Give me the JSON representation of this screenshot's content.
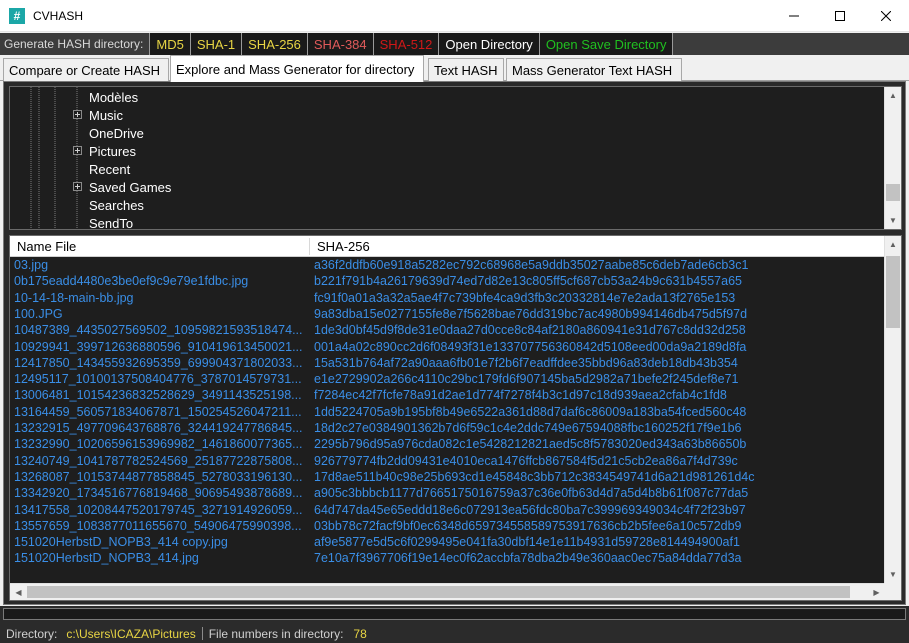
{
  "window": {
    "title": "CVHASH",
    "app_icon_glyph": "#"
  },
  "toolbar": {
    "label": "Generate HASH directory:",
    "buttons": [
      {
        "label": "MD5",
        "color": "#e8d544"
      },
      {
        "label": "SHA-1",
        "color": "#e8d544"
      },
      {
        "label": "SHA-256",
        "color": "#e8d544"
      },
      {
        "label": "SHA-384",
        "color": "#e05a5a"
      },
      {
        "label": "SHA-512",
        "color": "#d01818"
      },
      {
        "label": "Open Directory",
        "color": "#ffffff"
      },
      {
        "label": "Open Save Directory",
        "color": "#20c020"
      }
    ]
  },
  "tabs": [
    {
      "label": "Compare or Create HASH",
      "active": false
    },
    {
      "label": "Explore and Mass Generator for directory",
      "active": true
    },
    {
      "label": "Text HASH",
      "active": false
    },
    {
      "label": "Mass Generator Text HASH",
      "active": false
    }
  ],
  "tree": {
    "items": [
      {
        "label": "Modèles",
        "expandable": false
      },
      {
        "label": "Music",
        "expandable": true
      },
      {
        "label": "OneDrive",
        "expandable": false
      },
      {
        "label": "Pictures",
        "expandable": true
      },
      {
        "label": "Recent",
        "expandable": false
      },
      {
        "label": "Saved Games",
        "expandable": true
      },
      {
        "label": "Searches",
        "expandable": false
      },
      {
        "label": "SendTo",
        "expandable": false
      }
    ]
  },
  "file_list": {
    "columns": [
      "Name File",
      "SHA-256"
    ],
    "rows": [
      [
        "03.jpg",
        "a36f2ddfb60e918a5282ec792c68968e5a9ddb35027aabe85c6deb7ade6cb3c1"
      ],
      [
        "0b175eadd4480e3be0ef9c9e79e1fdbc.jpg",
        "b221f791b4a26179639d74ed7d82e13c805ff5cf687cb53a24b9c631b4557a65"
      ],
      [
        "10-14-18-main-bb.jpg",
        "fc91f0a01a3a32a5ae4f7c739bfe4ca9d3fb3c20332814e7e2ada13f2765e153"
      ],
      [
        "100.JPG",
        "9a83dba15e0277155fe8e7f5628bae76dd319bc7ac4980b994146db475d5f97d"
      ],
      [
        "10487389_4435027569502_10959821593518474...",
        "1de3d0bf45d9f8de31e0daa27d0cce8c84af2180a860941e31d767c8dd32d258"
      ],
      [
        "10929941_399712636880596_910419613450021...",
        "001a4a02c890cc2d6f08493f31e133707756360842d5108eed00da9a2189d8fa"
      ],
      [
        "12417850_143455932695359_699904371802033...",
        "15a531b764af72a90aaa6fb01e7f2b6f7eadffdee35bbd96a83deb18db43b354"
      ],
      [
        "12495117_10100137508404776_3787014579731...",
        "e1e2729902a266c4110c29bc179fd6f907145ba5d2982a71befe2f245def8e71"
      ],
      [
        "13006481_10154236832528629_3491143525198...",
        "f7284ec42f7fcfe78a91d2ae1d774f7278f4b3c1d97c18d939aea2cfab4c1fd8"
      ],
      [
        "13164459_560571834067871_150254526047211...",
        "1dd5224705a9b195bf8b49e6522a361d88d7daf6c86009a183ba54fced560c48"
      ],
      [
        "13232915_497709643768876_324419247786845...",
        "18d2c27e0384901362b7d6f59c1c4e2ddc749e67594088fbc160252f17f9e1b6"
      ],
      [
        "13232990_10206596153969982_1461860077365...",
        "2295b796d95a976cda082c1e5428212821aed5c8f5783020ed343a63b86650b"
      ],
      [
        "13240749_1041787782524569_25187722875808...",
        "926779774fb2dd09431e4010eca1476ffcb867584f5d21c5cb2ea86a7f4d739c"
      ],
      [
        "13268087_10153744877858845_5278033196130...",
        "17d8ae511b40c98e25b693cd1e45848c3bb712c3834549741d6a21d981261d4c"
      ],
      [
        "13342920_1734516776819468_90695493878689...",
        "a905c3bbbcb1177d7665175016759a37c36e0fb63d4d7a5d4b8b61f087c77da5"
      ],
      [
        "13417558_10208447520179745_3271914926059...",
        "64d747da45e65eddd18e6c072913ea56fdc80ba7c399969349034c4f72f23b97"
      ],
      [
        "13557659_1083877011655670_54906475990398...",
        "03bb78c72facf9bf0ec6348d659734558589753917636cb2b5fee6a10c572db9"
      ],
      [
        "151020HerbstD_NOPB3_414 copy.jpg",
        "af9e5877e5d5c6f0299495e041fa30dbf14e1e11b4931d59728e814494900af1"
      ],
      [
        "151020HerbstD_NOPB3_414.jpg",
        "7e10a7f3967706f19e14ec0f62accbfa78dba2b49e360aac0ec75a84dda77d3a"
      ]
    ]
  },
  "status": {
    "directory_label": "Directory:",
    "directory_value": "c:\\Users\\ICAZA\\Pictures",
    "count_label": "File numbers in directory:",
    "count_value": "78"
  },
  "colors": {
    "list_text": "#3a8ee6",
    "status_value": "#e8d544"
  }
}
